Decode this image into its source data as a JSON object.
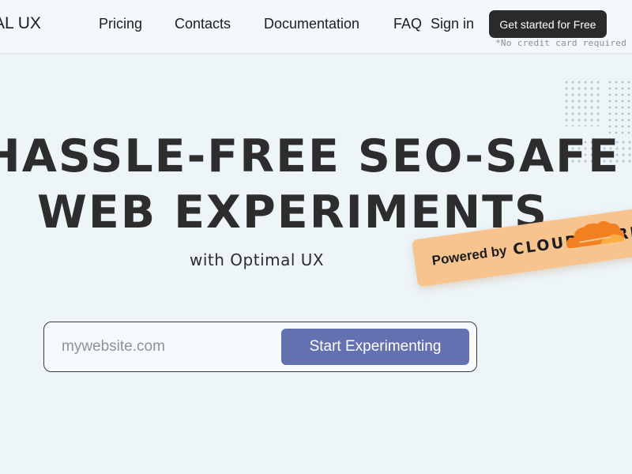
{
  "header": {
    "logo": "AL UX",
    "nav": {
      "pricing": "Pricing",
      "contacts": "Contacts",
      "documentation": "Documentation",
      "faq": "FAQ",
      "sign_in": "Sign in"
    },
    "cta_label": "Get started for Free",
    "cta_note": "*No credit card required"
  },
  "hero": {
    "title_line1": "HASSLE-FREE SEO-SAFE",
    "title_line2": "WEB EXPERIMENTS",
    "subtitle": "with Optimal UX"
  },
  "badge": {
    "powered_by": "Powered by",
    "brand": "CLOUDFLARE",
    "registered": "®"
  },
  "search": {
    "placeholder": "mywebsite.com",
    "value": "",
    "button_label": "Start Experimenting"
  },
  "colors": {
    "background": "#edf5f9",
    "primary_button": "#6471b0",
    "dark_button": "#2a2a2c",
    "badge": "#f7c48f",
    "cloudflare_orange": "#f38020"
  },
  "icons": [
    "cloudflare-cloud-icon",
    "dot-grid-decoration"
  ]
}
